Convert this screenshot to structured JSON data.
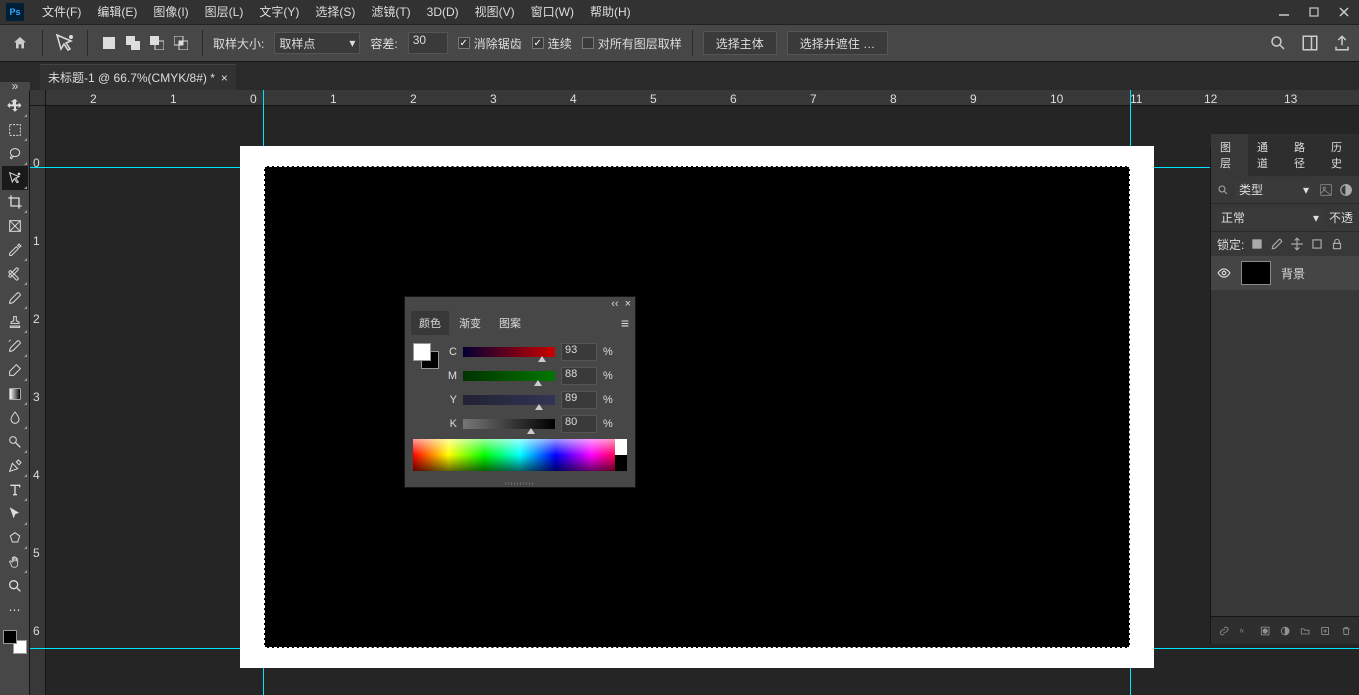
{
  "menu": {
    "items": [
      "文件(F)",
      "编辑(E)",
      "图像(I)",
      "图层(L)",
      "文字(Y)",
      "选择(S)",
      "滤镜(T)",
      "3D(D)",
      "视图(V)",
      "窗口(W)",
      "帮助(H)"
    ]
  },
  "options": {
    "sample_size_label": "取样大小:",
    "sample_size_value": "取样点",
    "tolerance_label": "容差:",
    "tolerance_value": "30",
    "antialias": "消除锯齿",
    "contiguous": "连续",
    "allLayers": "对所有图层取样",
    "select_subject": "选择主体",
    "select_mask": "选择并遮住 …"
  },
  "doc": {
    "title": "未标题-1 @ 66.7%(CMYK/8#) *"
  },
  "ruler_h": [
    "2",
    "1",
    "0",
    "1",
    "2",
    "3",
    "4",
    "5",
    "6",
    "7",
    "8",
    "9",
    "10",
    "11",
    "12",
    "13"
  ],
  "ruler_v": [
    "0",
    "1",
    "2",
    "3",
    "4",
    "5",
    "6"
  ],
  "color_panel": {
    "tabs": [
      "颜色",
      "渐变",
      "图案"
    ],
    "channels": [
      {
        "label": "C",
        "value": "93",
        "pct": "%",
        "pos": 86,
        "grad": "linear-gradient(to right,#003,#c00)"
      },
      {
        "label": "M",
        "value": "88",
        "pct": "%",
        "pos": 82,
        "grad": "linear-gradient(to right,#030,#070)"
      },
      {
        "label": "Y",
        "value": "89",
        "pct": "%",
        "pos": 83,
        "grad": "linear-gradient(to right,#223,#335)"
      },
      {
        "label": "K",
        "value": "80",
        "pct": "%",
        "pos": 74,
        "grad": "linear-gradient(to right,#777,#000)"
      }
    ]
  },
  "layers": {
    "tabs": [
      "图层",
      "通道",
      "路径",
      "历史"
    ],
    "type_filter": "类型",
    "blend": "正常",
    "opacity_label": "不透",
    "lock_label": "锁定:",
    "bg_layer": "背景"
  }
}
